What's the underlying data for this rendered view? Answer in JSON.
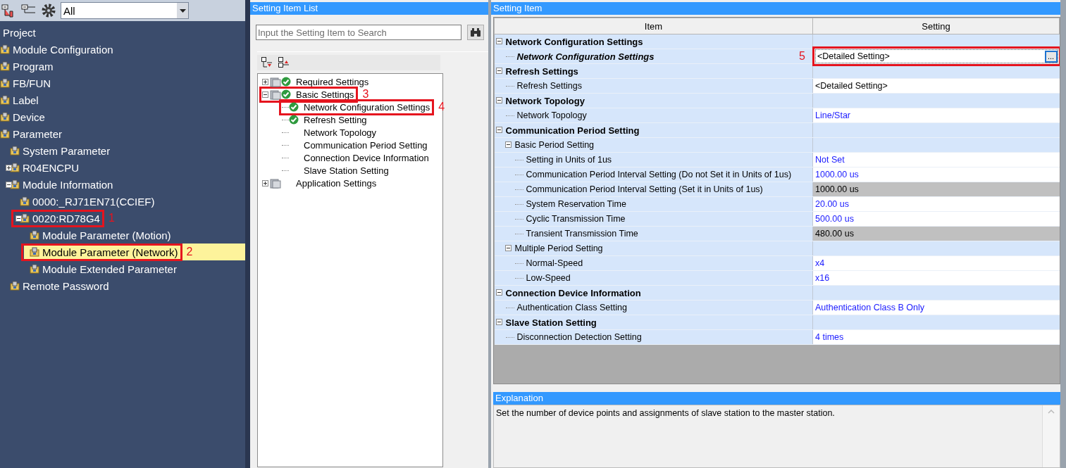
{
  "navigator": {
    "toolbar": {
      "filter": "All"
    },
    "tree": [
      {
        "label": "Project",
        "children": [
          {
            "label": "Module Configuration"
          },
          {
            "label": "Program"
          },
          {
            "label": "FB/FUN"
          },
          {
            "label": "Label"
          },
          {
            "label": "Device"
          },
          {
            "label": "Parameter",
            "children": [
              {
                "label": "System Parameter"
              },
              {
                "label": "R04ENCPU",
                "expanded": false
              },
              {
                "label": "Module Information",
                "expanded": true,
                "children": [
                  {
                    "label": "0000:_RJ71EN71(CCIEF)"
                  },
                  {
                    "label": "0020:RD78G4",
                    "expanded": true,
                    "annotation": "1",
                    "children": [
                      {
                        "label": "Module Parameter (Motion)",
                        "selected": false
                      },
                      {
                        "label": "Module Parameter (Network)",
                        "selected": true,
                        "annotation": "2"
                      },
                      {
                        "label": "Module Extended Parameter",
                        "selected": false
                      }
                    ]
                  }
                ]
              },
              {
                "label": "Remote Password"
              }
            ]
          }
        ]
      }
    ]
  },
  "setting_item_list": {
    "title": "Setting Item List",
    "search": {
      "placeholder": "Input the Setting Item to Search"
    },
    "tree": [
      {
        "label": "Required Settings",
        "expanded": false,
        "configured": true
      },
      {
        "label": "Basic Settings",
        "expanded": true,
        "configured": true,
        "annotation": "3",
        "children": [
          {
            "label": "Network Configuration Settings",
            "configured": true,
            "annotation": "4"
          },
          {
            "label": "Refresh Setting",
            "configured": true
          },
          {
            "label": "Network Topology",
            "configured": false
          },
          {
            "label": "Communication Period Setting",
            "configured": false
          },
          {
            "label": "Connection Device Information",
            "configured": false
          },
          {
            "label": "Slave Station Setting",
            "configured": false
          }
        ]
      },
      {
        "label": "Application Settings",
        "expanded": false,
        "configured": false
      }
    ]
  },
  "setting_item": {
    "title": "Setting Item",
    "columns": [
      "Item",
      "Setting"
    ],
    "rows": [
      {
        "item": "Network Configuration Settings",
        "expanded": true,
        "children": [
          {
            "item": "Network Configuration Settings",
            "value": "<Detailed Setting>",
            "editable": false,
            "read_only": false,
            "selected": true,
            "button": "...",
            "annotation": "5"
          }
        ]
      },
      {
        "item": "Refresh Settings",
        "expanded": true,
        "children": [
          {
            "item": "Refresh Settings",
            "value": "<Detailed Setting>",
            "editable": false,
            "read_only": false,
            "selected": false
          }
        ]
      },
      {
        "item": "Network Topology",
        "expanded": true,
        "children": [
          {
            "item": "Network Topology",
            "value": "Line/Star",
            "editable": true,
            "read_only": false,
            "selected": false
          }
        ]
      },
      {
        "item": "Communication Period Setting",
        "expanded": true,
        "children": [
          {
            "item": "Basic Period Setting",
            "expanded": true,
            "children": [
              {
                "item": "Setting in Units of 1us",
                "value": "Not Set",
                "editable": true,
                "read_only": false,
                "selected": false
              },
              {
                "item": "Communication Period Interval Setting (Do not Set it in Units of 1us)",
                "value": "1000.00 us",
                "editable": true,
                "read_only": false,
                "selected": false
              },
              {
                "item": "Communication Period Interval Setting (Set it in Units of 1us)",
                "value": "1000.00 us",
                "editable": false,
                "read_only": true,
                "selected": false
              },
              {
                "item": "System Reservation Time",
                "value": "20.00 us",
                "editable": true,
                "read_only": false,
                "selected": false
              },
              {
                "item": "Cyclic Transmission Time",
                "value": "500.00 us",
                "editable": true,
                "read_only": false,
                "selected": false
              },
              {
                "item": "Transient Transmission Time",
                "value": "480.00 us",
                "editable": false,
                "read_only": true,
                "selected": false
              }
            ]
          },
          {
            "item": "Multiple Period Setting",
            "expanded": true,
            "children": [
              {
                "item": "Normal-Speed",
                "value": "x4",
                "editable": true,
                "read_only": false,
                "selected": false
              },
              {
                "item": "Low-Speed",
                "value": "x16",
                "editable": true,
                "read_only": false,
                "selected": false
              }
            ]
          }
        ]
      },
      {
        "item": "Connection Device Information",
        "expanded": true,
        "children": [
          {
            "item": "Authentication Class Setting",
            "value": "Authentication Class B Only",
            "editable": true,
            "read_only": false,
            "selected": false
          }
        ]
      },
      {
        "item": "Slave Station Setting",
        "expanded": true,
        "children": [
          {
            "item": "Disconnection Detection Setting",
            "value": "4 times",
            "editable": true,
            "read_only": false,
            "selected": false
          }
        ]
      }
    ]
  },
  "explanation": {
    "title": "Explanation",
    "text": "Set the number of device points and assignments of slave station to the master station."
  }
}
